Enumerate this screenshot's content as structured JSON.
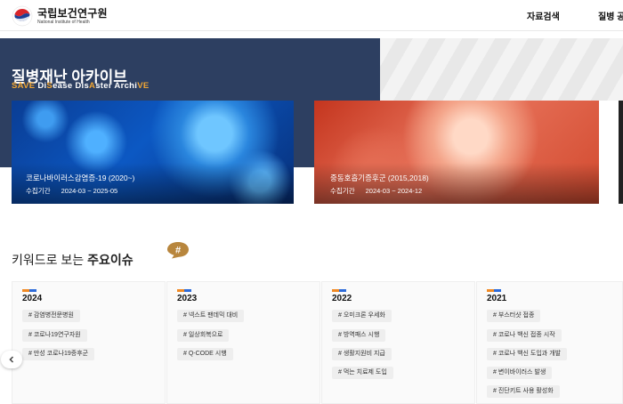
{
  "header": {
    "logo_ko": "국립보건연구원",
    "logo_en": "National Institute of Health",
    "nav": [
      "자료검색",
      "질병 공"
    ]
  },
  "hero": {
    "title": "질병재난 아카이브",
    "subtitle_parts": [
      {
        "text": "SAVE ",
        "hl": true
      },
      {
        "text": "Di",
        "hl": false
      },
      {
        "text": "S",
        "hl": true
      },
      {
        "text": "ease ",
        "hl": false
      },
      {
        "text": "Dis",
        "hl": false
      },
      {
        "text": "A",
        "hl": true
      },
      {
        "text": "ster ",
        "hl": false
      },
      {
        "text": "Archi",
        "hl": false
      },
      {
        "text": "VE",
        "hl": true
      }
    ],
    "cards": [
      {
        "title": "코로나바이러스감염증-19 (2020~)",
        "period_label": "수집기간",
        "period": "2024-03 ~ 2025-05"
      },
      {
        "title": "중동호흡기증후군 (2015,2018)",
        "period_label": "수집기간",
        "period": "2024-03 ~ 2024-12"
      }
    ]
  },
  "keywords": {
    "title_prefix": "키워드로 보는 ",
    "title_bold": "주요이슈",
    "badge": "#",
    "columns": [
      {
        "year": "2024",
        "tags": [
          "# 감염병전문병원",
          "# 코로나19연구자원",
          "# 만성 코로나19증후군"
        ]
      },
      {
        "year": "2023",
        "tags": [
          "# 넥스트 팬데믹 대비",
          "# 일상회복으로",
          "# Q-CODE 시행"
        ]
      },
      {
        "year": "2022",
        "tags": [
          "# 오미크론 우세화",
          "# 방역패스 시행",
          "# 생활지원비 지급",
          "# 먹는 치료제 도입"
        ]
      },
      {
        "year": "2021",
        "tags": [
          "# 부스터샷 접종",
          "# 코로나 백신 접종 시작",
          "# 코로나 백신 도입과 개발",
          "# 변이바이러스 발생",
          "# 진단키트 사용 활성화"
        ]
      }
    ]
  },
  "colors": {
    "hero_bg": "#2d3f61",
    "accent_orange": "#f1a634",
    "badge": "#b8863d"
  },
  "icons": [
    "government-emblem-icon",
    "hash-icon",
    "chevron-left-icon"
  ]
}
